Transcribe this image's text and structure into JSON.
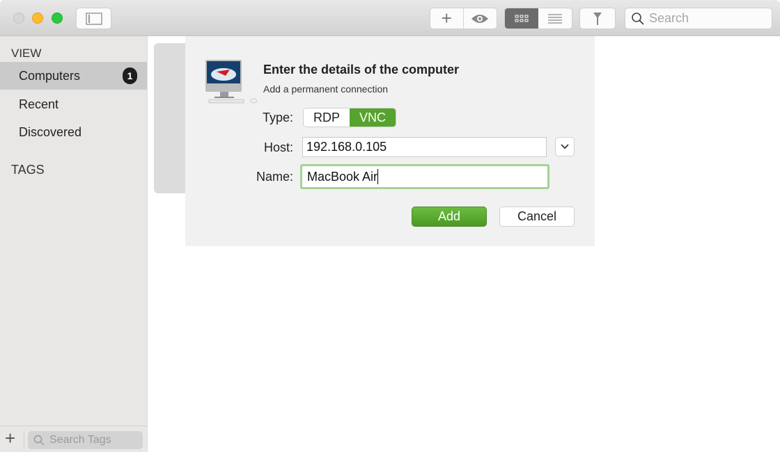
{
  "toolbar": {
    "search_placeholder": "Search"
  },
  "sidebar": {
    "view_header": "VIEW",
    "items": [
      {
        "label": "Computers",
        "badge": "1"
      },
      {
        "label": "Recent"
      },
      {
        "label": "Discovered"
      }
    ],
    "tags_header": "TAGS",
    "tag_search_placeholder": "Search Tags"
  },
  "dialog": {
    "title": "Enter the details of the computer",
    "subtitle": "Add a permanent connection",
    "type_label": "Type:",
    "type_options": [
      "RDP",
      "VNC"
    ],
    "type_selected": "VNC",
    "host_label": "Host:",
    "host_value": "192.168.0.105",
    "name_label": "Name:",
    "name_value": "MacBook Air",
    "add_label": "Add",
    "cancel_label": "Cancel"
  },
  "colors": {
    "accent": "#56a32d",
    "focus_ring": "#a3d394"
  }
}
